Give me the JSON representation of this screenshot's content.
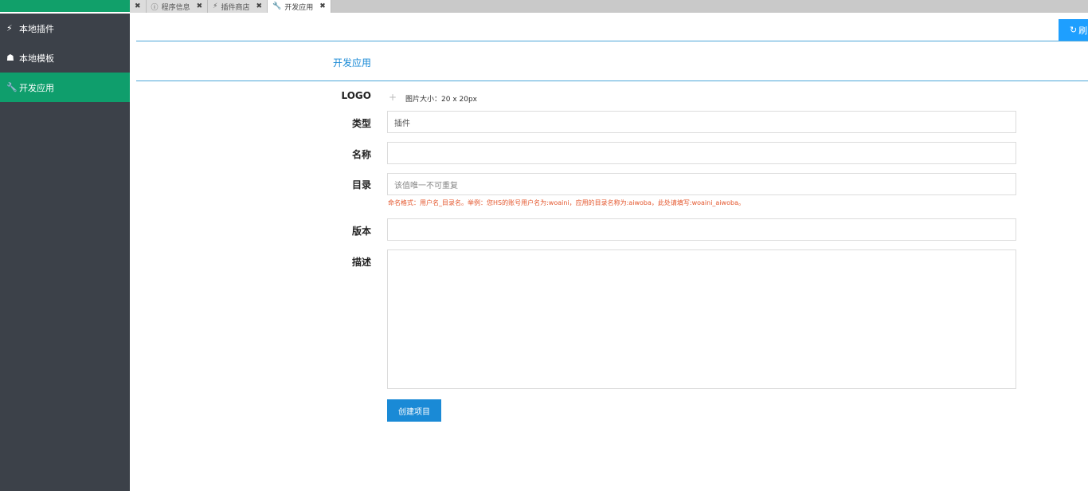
{
  "sidebar": {
    "items": [
      {
        "label": "本地插件",
        "icon": "plug-icon"
      },
      {
        "label": "本地模板",
        "icon": "sitemap-icon"
      },
      {
        "label": "开发应用",
        "icon": "wrench-icon",
        "active": true
      }
    ]
  },
  "tabs": [
    {
      "label": "",
      "close": "✖"
    },
    {
      "label": "程序信息",
      "icon": "info-icon",
      "close": "✖"
    },
    {
      "label": "插件商店",
      "icon": "plug-icon",
      "close": "✖"
    },
    {
      "label": "开发应用",
      "icon": "wrench-icon",
      "close": "✖",
      "active": true
    }
  ],
  "toolbar": {
    "refresh_label": "刷"
  },
  "page": {
    "title": "开发应用"
  },
  "form": {
    "logo_label": "LOGO",
    "logo_hint": "图片大小：20 x 20px",
    "type_label": "类型",
    "type_value": "插件",
    "name_label": "名称",
    "name_value": "",
    "dir_label": "目录",
    "dir_placeholder": "该值唯一不可重复",
    "dir_hint": "命名格式：用户名_目录名。举例：您HS的账号用户名为:woaini，应用的目录名称为:aiwoba，此处请填写:woaini_aiwoba。",
    "version_label": "版本",
    "version_value": "",
    "desc_label": "描述",
    "desc_value": "",
    "submit_label": "创建项目"
  },
  "colors": {
    "sidebar_bg": "#3c4149",
    "active_green": "#0f9e6c",
    "accent_blue": "#1a8ad6",
    "refresh_blue": "#1e9fff",
    "hint_red": "#e4572e"
  }
}
